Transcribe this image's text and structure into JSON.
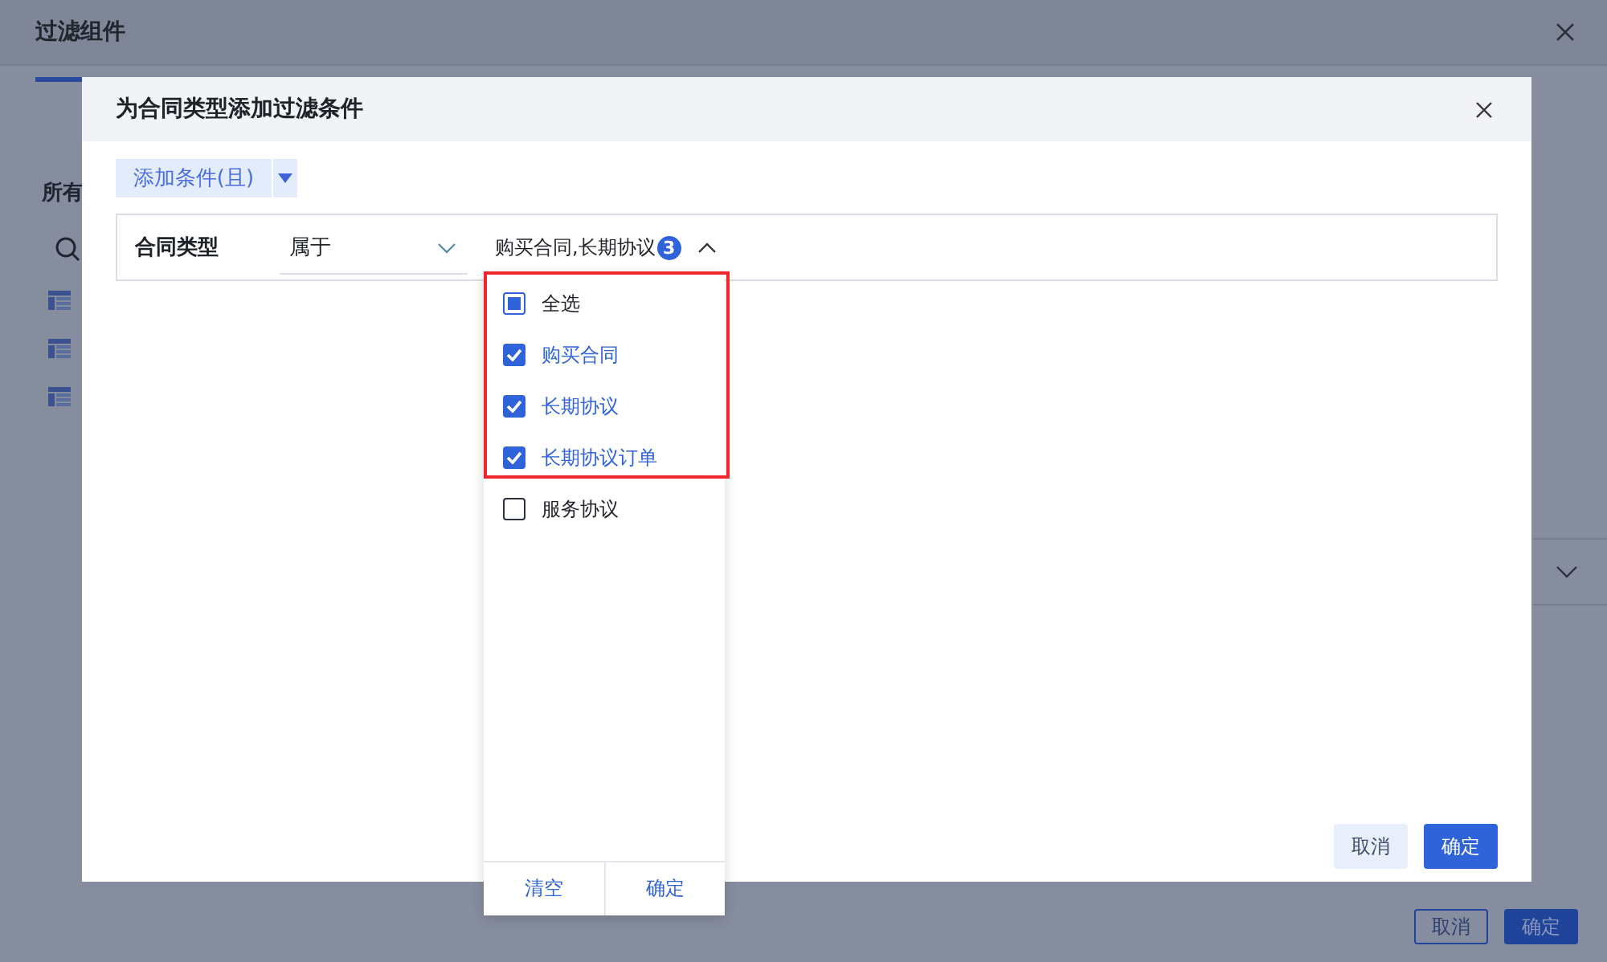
{
  "background": {
    "title": "过滤组件",
    "section_label": "所有",
    "buttons": [
      {
        "label": "取消",
        "kind": "secondary"
      },
      {
        "label": "确定",
        "kind": "primary"
      }
    ]
  },
  "dialog": {
    "title": "为合同类型添加过滤条件",
    "add_button": "添加条件(且)",
    "condition": {
      "field": "合同类型",
      "operator": "属于",
      "value": "购买合同,长期协议",
      "count": "3",
      "expanded": true
    },
    "buttons": [
      {
        "label": "取消",
        "kind": "secondary"
      },
      {
        "label": "确定",
        "kind": "primary"
      }
    ]
  },
  "dropdown": {
    "options": [
      {
        "label": "全选",
        "kind": "select-all",
        "checked": false,
        "indeterminate": true
      },
      {
        "label": "购买合同",
        "kind": "option",
        "checked": true
      },
      {
        "label": "长期协议",
        "kind": "option",
        "checked": true
      },
      {
        "label": "长期协议订单",
        "kind": "option",
        "checked": true
      },
      {
        "label": "服务协议",
        "kind": "option",
        "checked": false
      }
    ],
    "highlight": true,
    "footer": [
      "清空",
      "确定"
    ]
  }
}
